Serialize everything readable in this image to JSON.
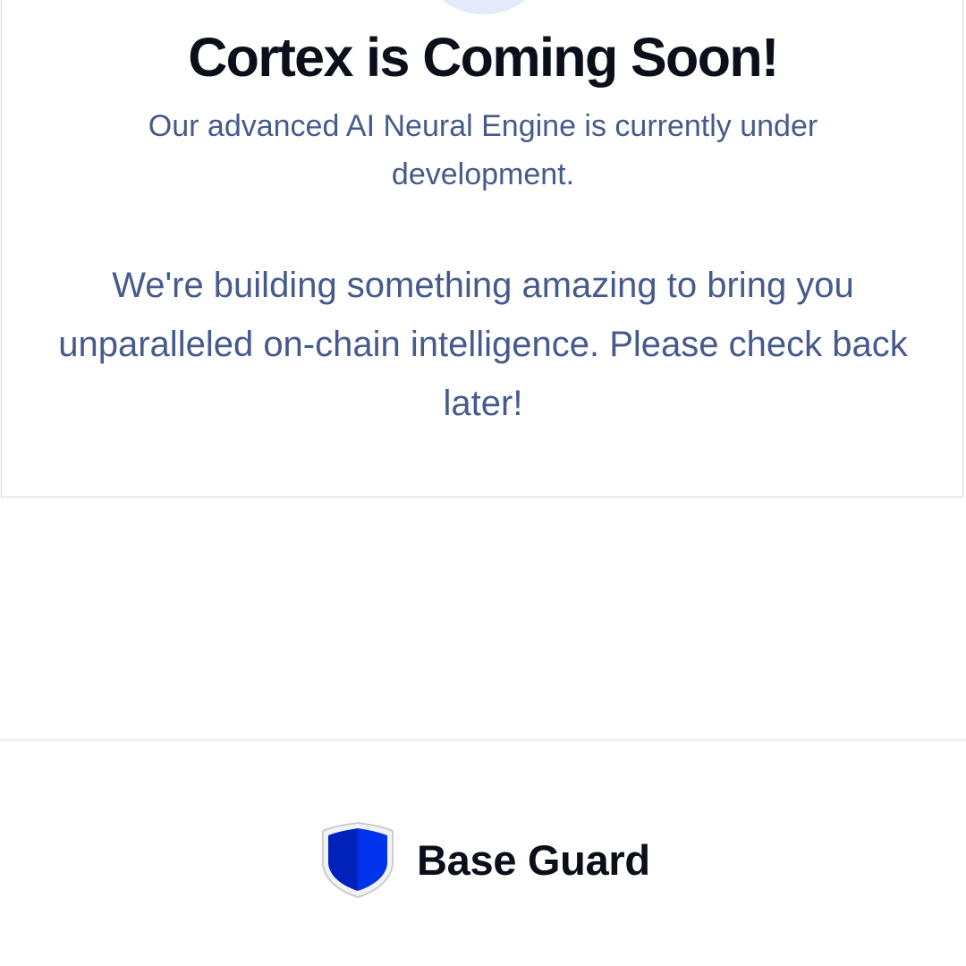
{
  "coming_soon": {
    "title": "Cortex is Coming Soon!",
    "subtitle": "Our advanced AI Neural Engine is currently under development.",
    "message": "We're building something amazing to bring you unparalleled on-chain intelligence. Please check back later!",
    "icon": "coming-soon-icon"
  },
  "footer": {
    "brand_name": "Base Guard",
    "logo_icon": "shield-icon"
  },
  "colors": {
    "title": "#0b0f19",
    "body_text": "#465a8c",
    "icon_circle": "#e4eafb",
    "shield_blue": "#0033ee",
    "shield_dark": "#0022bb"
  }
}
